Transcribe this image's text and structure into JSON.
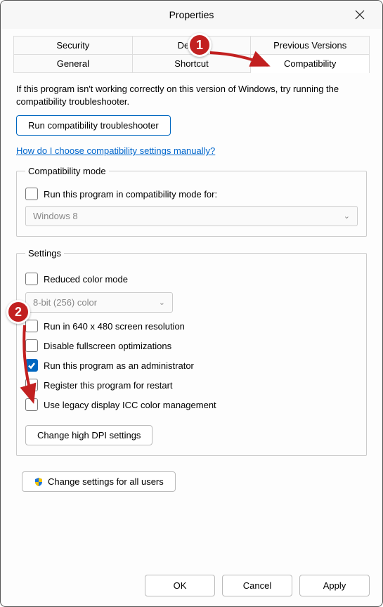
{
  "window": {
    "title": "Properties"
  },
  "tabs": {
    "row1": [
      "Security",
      "Details",
      "Previous Versions"
    ],
    "row2": [
      "General",
      "Shortcut",
      "Compatibility"
    ],
    "active": "Compatibility"
  },
  "intro": "If this program isn't working correctly on this version of Windows, try running the compatibility troubleshooter.",
  "troubleshooter_btn": "Run compatibility troubleshooter",
  "help_link": "How do I choose compatibility settings manually?",
  "compat_mode": {
    "legend": "Compatibility mode",
    "checkbox": "Run this program in compatibility mode for:",
    "select_value": "Windows 8"
  },
  "settings": {
    "legend": "Settings",
    "reduced_color": "Reduced color mode",
    "color_select": "8-bit (256) color",
    "run_640": "Run in 640 x 480 screen resolution",
    "disable_fullscreen": "Disable fullscreen optimizations",
    "run_admin": "Run this program as an administrator",
    "register_restart": "Register this program for restart",
    "legacy_icc": "Use legacy display ICC color management",
    "dpi_btn": "Change high DPI settings"
  },
  "all_users_btn": "Change settings for all users",
  "footer": {
    "ok": "OK",
    "cancel": "Cancel",
    "apply": "Apply"
  },
  "annotations": {
    "badge1": "1",
    "badge2": "2"
  }
}
